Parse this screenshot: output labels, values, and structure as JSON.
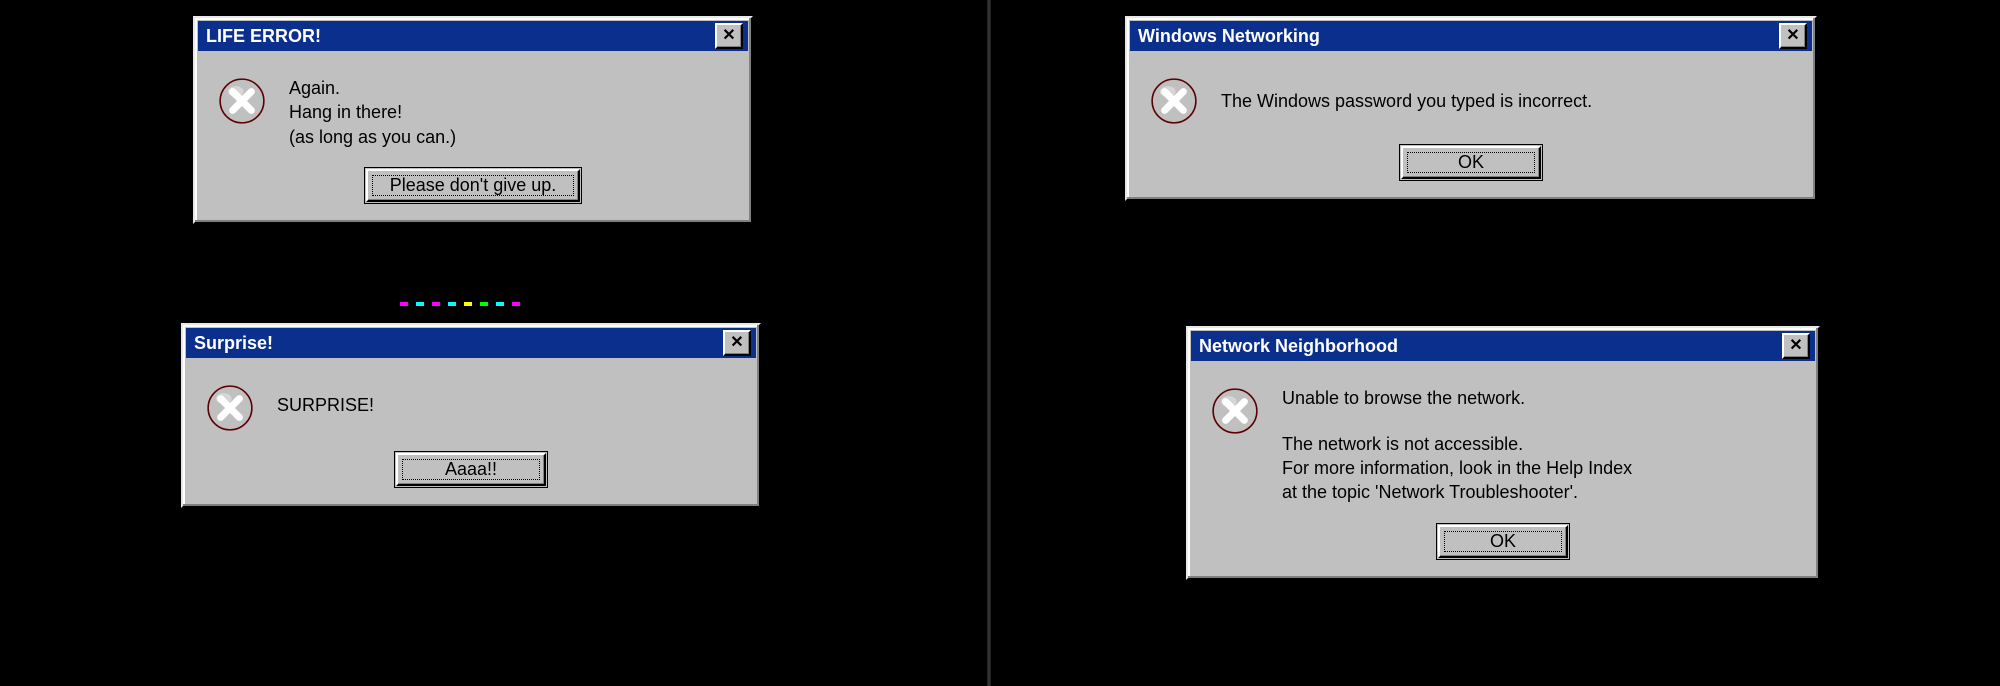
{
  "dialogs": {
    "life_error": {
      "title": "LIFE ERROR!",
      "lines": [
        "Again.",
        "Hang in there!",
        "(as long as you can.)"
      ],
      "button": "Please don't give up."
    },
    "surprise": {
      "title": "Surprise!",
      "lines": [
        "SURPRISE!"
      ],
      "button": "Aaaa!!"
    },
    "win_net": {
      "title": "Windows Networking",
      "lines": [
        "The Windows password you typed is incorrect."
      ],
      "button": "OK"
    },
    "net_hood": {
      "title": "Network Neighborhood",
      "lines": [
        "Unable to browse the network.",
        "",
        "The network is not accessible.",
        "For more information, look in the Help Index",
        "at the topic 'Network Troubleshooter'."
      ],
      "button": "OK"
    }
  },
  "icons": {
    "close_glyph": "✕"
  },
  "colors": {
    "titlebar": "#0b2f8c",
    "face": "#c0c0c0",
    "error_red": "#d2232a"
  }
}
